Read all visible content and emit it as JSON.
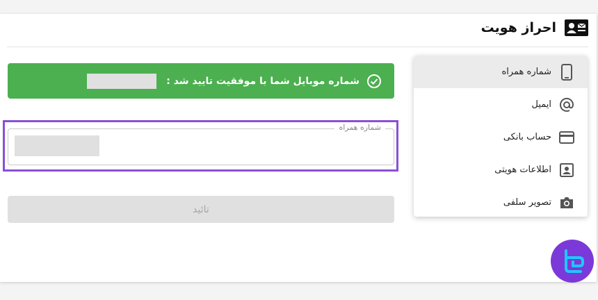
{
  "header": {
    "title": "احراز هویت",
    "icon": "id-card-icon"
  },
  "menu": {
    "items": [
      {
        "label": "شماره همراه",
        "icon": "phone-icon",
        "active": true
      },
      {
        "label": "ایمیل",
        "icon": "at-icon",
        "active": false
      },
      {
        "label": "حساب بانکی",
        "icon": "credit-card-icon",
        "active": false
      },
      {
        "label": "اطلاعات هویتی",
        "icon": "portrait-icon",
        "active": false
      },
      {
        "label": "تصویر سلفی",
        "icon": "camera-icon",
        "active": false
      }
    ]
  },
  "alert": {
    "text": "شماره موبایل شما با موفقیت تایید شد :",
    "icon": "check-circle-icon",
    "color": "#4caf50"
  },
  "phone_field": {
    "label": "شماره همراه"
  },
  "submit": {
    "label": "تائید"
  },
  "colors": {
    "highlight": "#8a4fd6",
    "logo": "#7b39d9"
  }
}
